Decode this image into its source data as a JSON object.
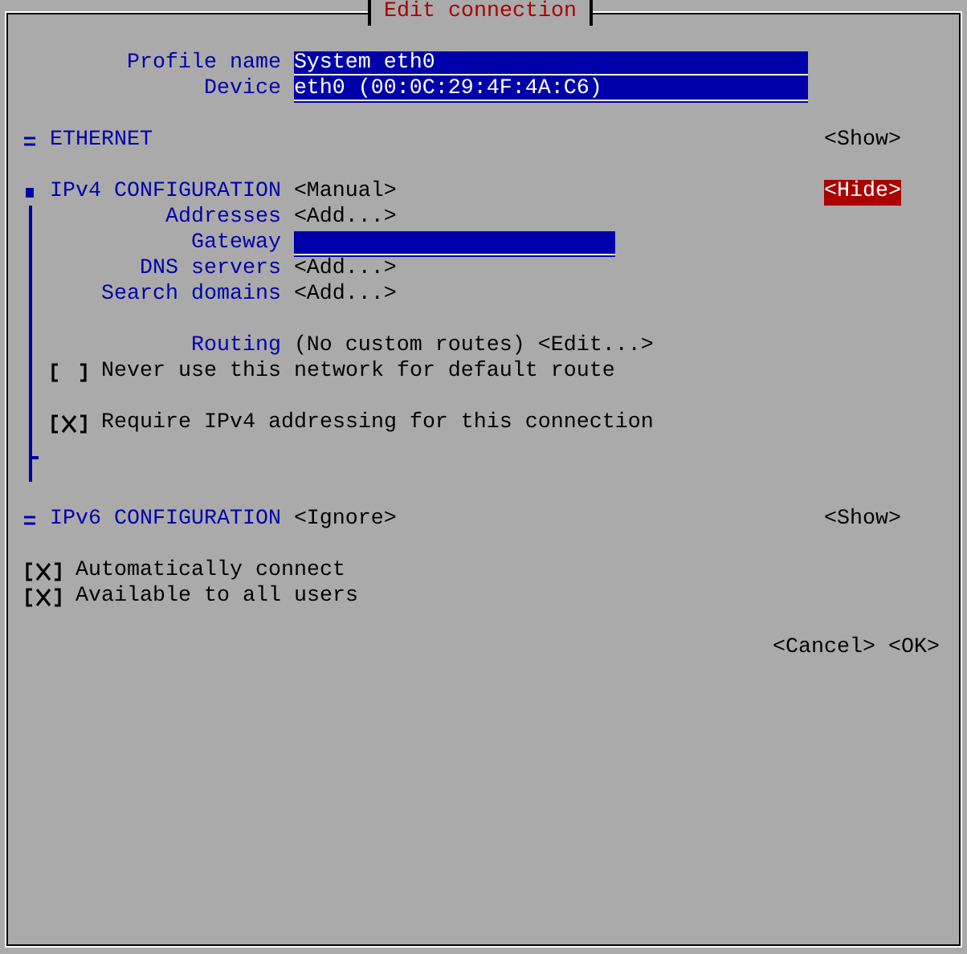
{
  "window": {
    "title": "Edit connection"
  },
  "fields": [
    {
      "label": "Profile name",
      "value": "System eth0"
    },
    {
      "label": "Device",
      "value": "eth0 (00:0C:29:4F:4A:C6)"
    }
  ],
  "sections": [
    {
      "title": "ETHERNET",
      "expanded": false,
      "toggle": {
        "label": "<Show>",
        "focused": false
      }
    },
    {
      "title": "IPv4 CONFIGURATION",
      "mode": "<Manual>",
      "expanded": true,
      "toggle": {
        "label": "<Hide>",
        "focused": true
      },
      "rows": [
        {
          "kind": "button",
          "label": "Addresses",
          "value": "<Add...>"
        },
        {
          "kind": "input",
          "label": "Gateway"
        },
        {
          "kind": "button",
          "label": "DNS servers",
          "value": "<Add...>"
        },
        {
          "kind": "button",
          "label": "Search domains",
          "value": "<Add...>"
        },
        {
          "kind": "routing",
          "label": "Routing",
          "value": "(No custom routes)",
          "button": "<Edit...>"
        },
        {
          "kind": "checkbox",
          "label": "Never use this network for default route",
          "checked": false
        },
        {
          "kind": "checkbox",
          "label": "Require IPv4 addressing for this connection",
          "checked": true
        }
      ]
    },
    {
      "title": "IPv6 CONFIGURATION",
      "mode": "<Ignore>",
      "expanded": false,
      "toggle": {
        "label": "<Show>",
        "focused": false
      }
    }
  ],
  "options": [
    {
      "label": "Automatically connect",
      "checked": true
    },
    {
      "label": "Available to all users",
      "checked": true
    }
  ],
  "buttons": [
    "<Cancel>",
    "<OK>"
  ]
}
